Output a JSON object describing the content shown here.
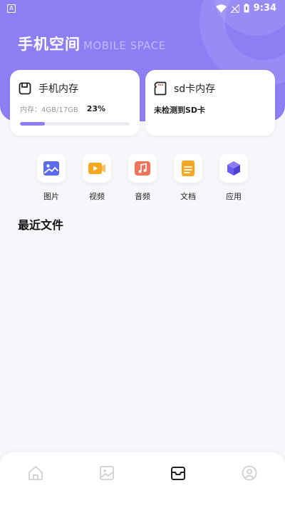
{
  "status_bar": {
    "app_icon_letter": "A",
    "time": "9:34"
  },
  "header": {
    "title": "手机空间",
    "subtitle": "MOBILE SPACE"
  },
  "phone_storage": {
    "title": "手机内存",
    "usage_text": "内存：4GB/17GB",
    "percent_label": "23%",
    "progress_fraction": 0.23
  },
  "sd_storage": {
    "title": "sd卡内存",
    "message": "未检测到SD卡"
  },
  "categories": [
    {
      "label": "图片",
      "icon": "image-icon",
      "color": "#5b6cf0"
    },
    {
      "label": "视频",
      "icon": "video-icon",
      "color": "#f5a623"
    },
    {
      "label": "音频",
      "icon": "music-icon",
      "color": "#f0735a"
    },
    {
      "label": "文档",
      "icon": "document-icon",
      "color": "#f5a623"
    },
    {
      "label": "应用",
      "icon": "app-cube-icon",
      "color": "#6a5cf0"
    }
  ],
  "recent_files": {
    "title": "最近文件"
  },
  "bottom_nav": [
    {
      "icon": "home-icon",
      "active": false
    },
    {
      "icon": "gallery-icon",
      "active": false
    },
    {
      "icon": "storage-box-icon",
      "active": true
    },
    {
      "icon": "profile-icon",
      "active": false
    }
  ],
  "colors": {
    "accent": "#8d7ef4",
    "inactive_nav": "#cfcfd6",
    "active_nav": "#222222"
  }
}
